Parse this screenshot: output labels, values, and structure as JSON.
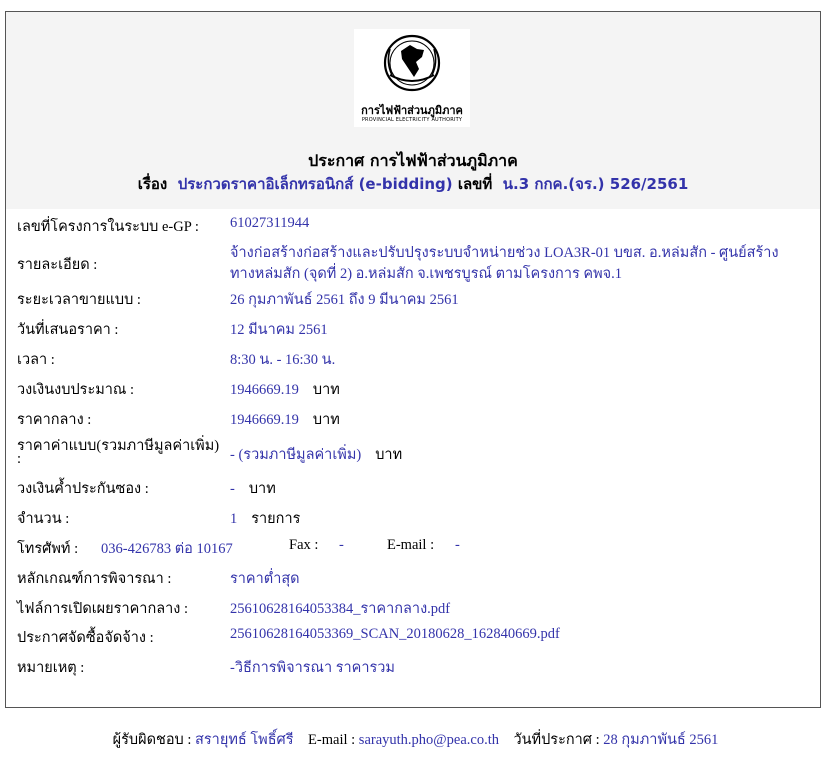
{
  "logo": {
    "org_th": "การไฟฟ้าส่วนภูมิภาค",
    "org_en": "PROVINCIAL ELECTRICITY AUTHORITY"
  },
  "announcement": {
    "title": "ประกาศ การไฟฟ้าส่วนภูมิภาค",
    "subject_label": "เรื่อง",
    "subject": "ประกวดราคาอิเล็กทรอนิกส์ (e-bidding)",
    "number_label": "เลขที่",
    "number": "น.3 กกค.(จร.) 526/2561"
  },
  "fields": {
    "project_id_label": "เลขที่โครงการในระบบ e-GP :",
    "project_id": "61027311944",
    "detail_label": "รายละเอียด :",
    "detail_line1": "จ้างก่อสร้างก่อสร้างและปรับปรุงระบบจำหน่ายช่วง LOA3R-01 บขส. อ.หล่มสัก - ศูนย์สร้าง",
    "detail_line2": "ทางหล่มสัก (จุดที่ 2) อ.หล่มสัก จ.เพชรบูรณ์ ตามโครงการ คพจ.1",
    "sale_period_label": "ระยะเวลาขายแบบ :",
    "sale_period": "26 กุมภาพันธ์ 2561 ถึง 9 มีนาคม 2561",
    "bid_date_label": "วันที่เสนอราคา :",
    "bid_date": "12 มีนาคม 2561",
    "time_label": "เวลา :",
    "time": "8:30 น. - 16:30 น.",
    "budget_label": "วงเงินงบประมาณ :",
    "budget": "1946669.19",
    "budget_unit": "บาท",
    "median_price_label": "ราคากลาง :",
    "median_price": "1946669.19",
    "median_price_unit": "บาท",
    "doc_price_label_line1": "ราคาค่าแบบ(รวมภาษีมูลค่าเพิ่ม)",
    "doc_price_label_line2": ":",
    "doc_price": "- (รวมภาษีมูลค่าเพิ่ม)",
    "doc_price_unit": "บาท",
    "guarantee_label": "วงเงินค้ำประกันซอง :",
    "guarantee": "-",
    "guarantee_unit": "บาท",
    "quantity_label": "จำนวน :",
    "quantity": "1",
    "quantity_unit": "รายการ",
    "phone_label": "โทรศัพท์ :",
    "phone": "036-426783 ต่อ 10167",
    "fax_label": "Fax :",
    "fax": "-",
    "email_label": "E-mail :",
    "email": "-",
    "criteria_label": "หลักเกณฑ์การพิจารณา :",
    "criteria": "ราคาต่ำสุด",
    "disclosure_file_label": "ไฟล์การเปิดเผยราคากลาง :",
    "disclosure_file": "25610628164053384_ราคากลาง.pdf",
    "procurement_file_label": "ประกาศจัดซื้อจัดจ้าง :",
    "procurement_file": "25610628164053369_SCAN_20180628_162840669.pdf",
    "remark_label": "หมายเหตุ :",
    "remark": "-วิธีการพิจารณา ราคารวม"
  },
  "footer": {
    "responsible_label": "ผู้รับผิดชอบ :",
    "responsible": "สรายุทธ์ โพธิ์ศรี",
    "email_label": "E-mail :",
    "email": "sarayuth.pho@pea.co.th",
    "date_label": "วันที่ประกาศ :",
    "date": "28 กุมภาพันธ์ 2561"
  }
}
